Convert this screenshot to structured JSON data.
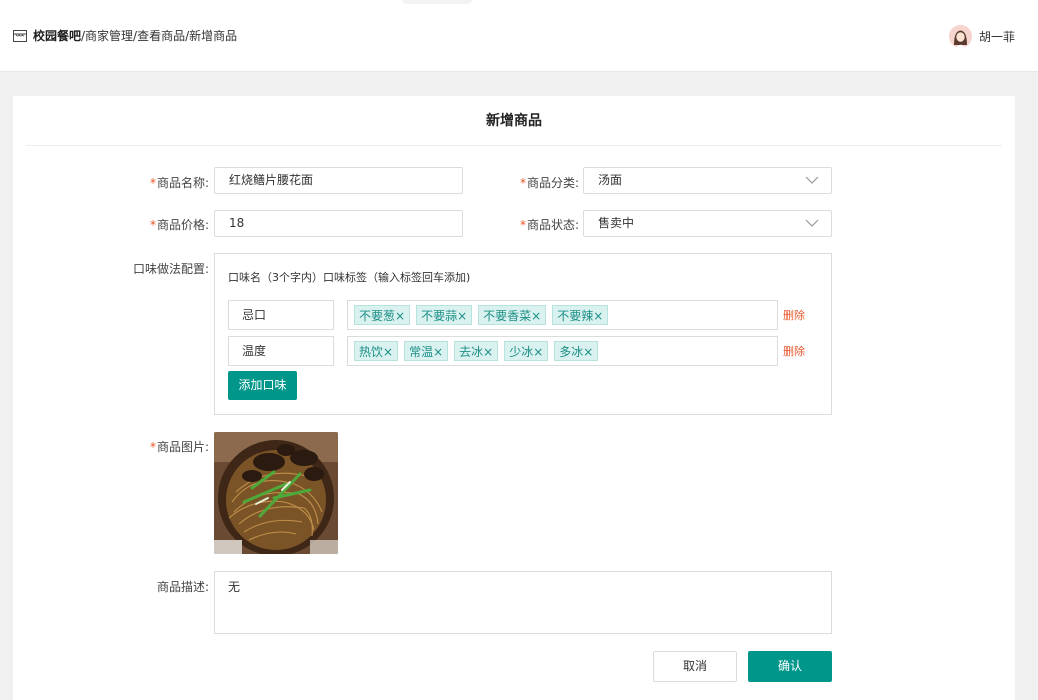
{
  "header": {
    "brand": "校园餐吧",
    "breadcrumb_rest": "/商家管理/查看商品/新增商品",
    "store_icon": "store-icon",
    "user_name": "胡一菲"
  },
  "form": {
    "title": "新增商品",
    "name_label": "商品名称:",
    "name_value": "红烧鳝片腰花面",
    "category_label": "商品分类:",
    "category_value": "汤面",
    "price_label": "商品价格:",
    "price_value": "18",
    "status_label": "商品状态:",
    "status_value": "售卖中",
    "flavor_label": "口味做法配置:",
    "flavor_hint": "口味名（3个字内）口味标签（输入标签回车添加)",
    "flavors": [
      {
        "name": "忌口",
        "tags": [
          "不要葱×",
          "不要蒜×",
          "不要香菜×",
          "不要辣×"
        ],
        "delete_label": "删除"
      },
      {
        "name": "温度",
        "tags": [
          "热饮×",
          "常温×",
          "去冰×",
          "少冰×",
          "多冰×"
        ],
        "delete_label": "删除"
      }
    ],
    "add_flavor_label": "添加口味",
    "image_label": "商品图片:",
    "description_label": "商品描述:",
    "description_value": "无",
    "required_mark": "*"
  },
  "actions": {
    "cancel_label": "取消",
    "confirm_label": "确认"
  },
  "colors": {
    "accent": "#00968a",
    "danger": "#e8562a"
  }
}
